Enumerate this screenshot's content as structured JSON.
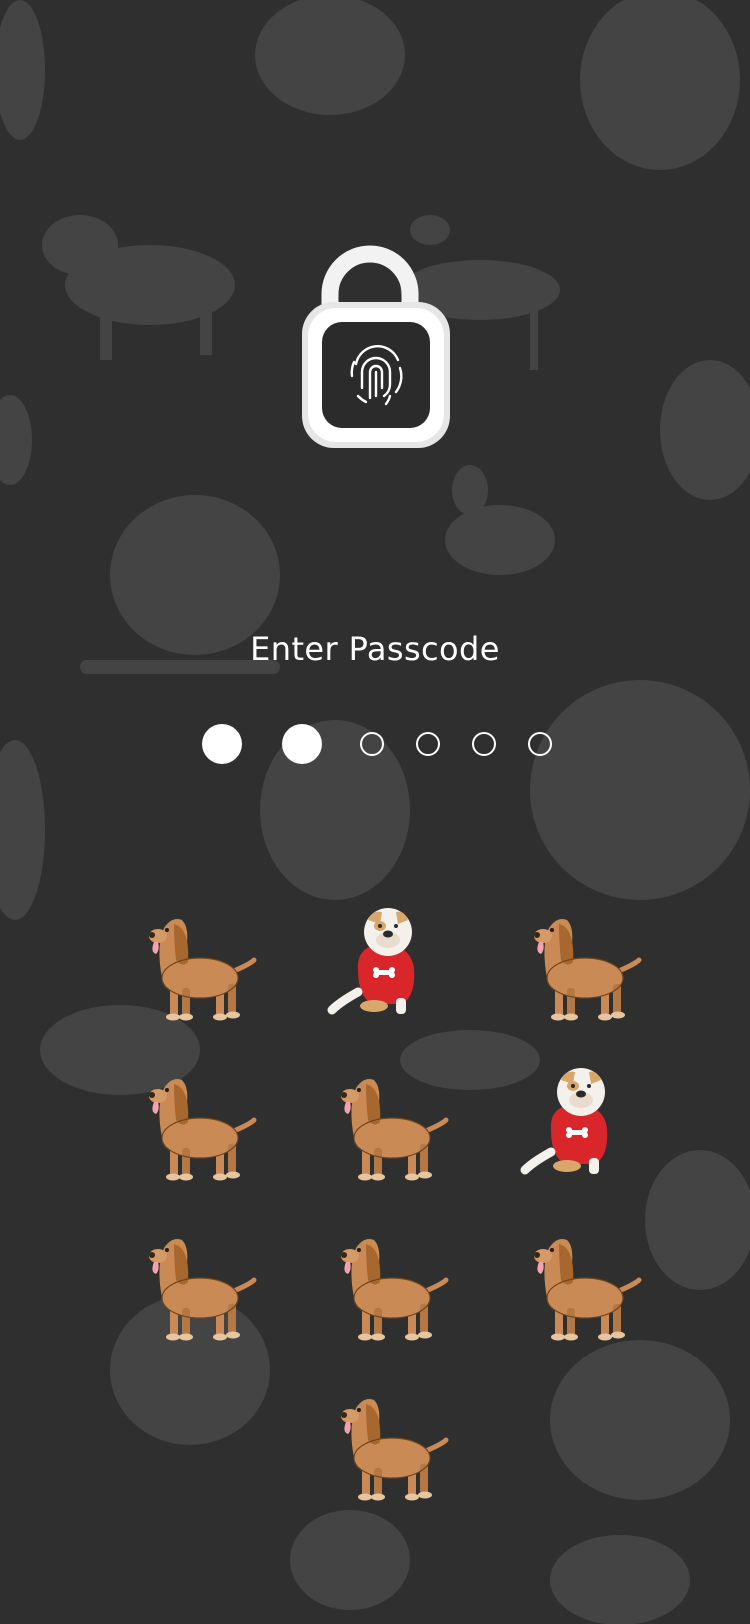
{
  "screen": {
    "prompt": "Enter Passcode",
    "background_color": "#2f2f2f"
  },
  "lock_icon": "open-padlock-fingerprint-icon",
  "passcode": {
    "length": 6,
    "entered": 2
  },
  "keypad": {
    "keys": [
      {
        "dog": "hound",
        "row": 0,
        "col": 0
      },
      {
        "dog": "bulldog-red-sweater",
        "row": 0,
        "col": 1
      },
      {
        "dog": "hound",
        "row": 0,
        "col": 2
      },
      {
        "dog": "hound",
        "row": 1,
        "col": 0
      },
      {
        "dog": "hound",
        "row": 1,
        "col": 1
      },
      {
        "dog": "bulldog-red-sweater",
        "row": 1,
        "col": 2
      },
      {
        "dog": "hound",
        "row": 2,
        "col": 0
      },
      {
        "dog": "hound",
        "row": 2,
        "col": 1
      },
      {
        "dog": "hound",
        "row": 2,
        "col": 2
      },
      {
        "dog": "hound",
        "row": 3,
        "col": 1
      }
    ]
  },
  "colors": {
    "hound": "#c98a55",
    "bulldog_sweater": "#d8262b",
    "bulldog_body": "#f4f1ec",
    "dots": "#ffffff"
  }
}
